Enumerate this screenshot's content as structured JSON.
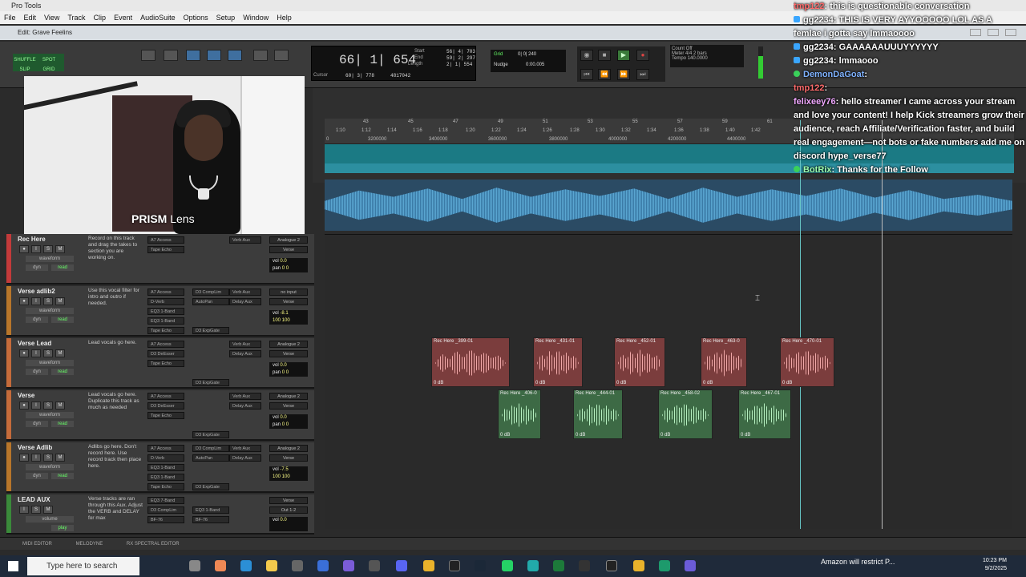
{
  "app": {
    "title": "Pro Tools",
    "edit_window_title": "Edit: Grave Feelins"
  },
  "menu": [
    "File",
    "Edit",
    "View",
    "Track",
    "Clip",
    "Event",
    "AudioSuite",
    "Options",
    "Setup",
    "Window",
    "Help"
  ],
  "toolbar": {
    "modes": [
      "SHUFFLE",
      "SPOT",
      "SLIP",
      "GRID"
    ],
    "grid_label": "Grid",
    "grid_value": "0| 0| 240",
    "nudge_label": "Nudge",
    "nudge_value": "0:00.005",
    "counter_main": "66| 1| 654",
    "start_label": "Start",
    "start_value": "56| 4| 703",
    "end_label": "End",
    "end_value": "59| 2| 297",
    "length_label": "Length",
    "length_value": "2| 1| 554",
    "cursor_label": "Cursor",
    "cursor_value": "60| 3| 778",
    "cursor_samples": "4817042",
    "count_off": "Count Off",
    "meter_label": "Meter",
    "meter_value": "4/4",
    "bars": "2 bars",
    "tempo_label": "Tempo",
    "tempo_value": "140.0000"
  },
  "ruler": {
    "bars": [
      "43",
      "45",
      "47",
      "49",
      "51",
      "53",
      "55",
      "57",
      "59",
      "61"
    ],
    "times": [
      "1:10",
      "1:12",
      "1:14",
      "1:16",
      "1:18",
      "1:20",
      "1:22",
      "1:24",
      "1:26",
      "1:28",
      "1:30",
      "1:32",
      "1:34",
      "1:36",
      "1:38",
      "1:40",
      "1:42"
    ],
    "samples": [
      "3200000",
      "3400000",
      "3600000",
      "3800000",
      "4000000",
      "4200000",
      "4400000"
    ],
    "start_marker": "0"
  },
  "webcam": {
    "overlay_brand": "PRISM",
    "overlay_suffix": "Lens"
  },
  "tracks": [
    {
      "name": "Rec Here",
      "color": "#c33a3a",
      "comment": "Record on this track and drag the takes to section you are working on.",
      "inserts": [
        "A7 Access",
        "Tape Echo"
      ],
      "sends": [
        "Verb Aux"
      ],
      "io": [
        "Analogue 2",
        "Verse"
      ],
      "vol": "0.0",
      "pan": "0 0",
      "view": "waveform",
      "dyn": "dyn",
      "mode": "read"
    },
    {
      "name": "Verse adlib2",
      "color": "#b8762a",
      "comment": "Use this vocal filter for intro and outro if needed.",
      "inserts": [
        "A7 Access",
        "D-Verb",
        "EQ3 1-Band",
        "EQ3 1-Band",
        "Tape Echo"
      ],
      "inserts2": [
        "D3 CompLim",
        "AutoPan",
        "",
        "",
        "D3 ExpGate"
      ],
      "sends": [
        "Verb Aux",
        "Delay Aux"
      ],
      "io": [
        "no input",
        "Verse"
      ],
      "vol": "-8.1",
      "pan": "100 100",
      "view": "waveform",
      "dyn": "dyn",
      "mode": "read"
    },
    {
      "name": "Verse Lead",
      "color": "#c56b3a",
      "comment": "Lead vocals go here.",
      "inserts": [
        "A7 Access",
        "D3 DeEsser",
        "Tape Echo"
      ],
      "inserts2": [
        "",
        "",
        "D3 ExpGate"
      ],
      "sends": [
        "Verb Aux",
        "Delay Aux"
      ],
      "io": [
        "Analogue 2",
        "Verse"
      ],
      "vol": "0.0",
      "pan": "0 0",
      "view": "waveform",
      "dyn": "dyn",
      "mode": "read"
    },
    {
      "name": "Verse",
      "color": "#c56b3a",
      "comment": "Lead vocals go here. Duplicate this track as much as needed",
      "inserts": [
        "A7 Access",
        "D3 DeEsser",
        "Tape Echo"
      ],
      "inserts2": [
        "",
        "",
        "D3 ExpGate"
      ],
      "sends": [
        "Verb Aux",
        "Delay Aux"
      ],
      "io": [
        "Analogue 2",
        "Verse"
      ],
      "vol": "0.0",
      "pan": "0 0",
      "view": "waveform",
      "dyn": "dyn",
      "mode": "read"
    },
    {
      "name": "Verse Adlib",
      "color": "#b8762a",
      "comment": "Adlibs go here. Don't record here. Use record track then place here.",
      "inserts": [
        "A7 Access",
        "D-Verb",
        "EQ3 1-Band",
        "EQ3 1-Band",
        "Tape Echo"
      ],
      "inserts2": [
        "D3 CompLim",
        "AutoPan",
        "",
        "",
        "D3 ExpGate"
      ],
      "sends": [
        "Verb Aux",
        "Delay Aux"
      ],
      "io": [
        "Analogue 2",
        "Verse"
      ],
      "vol": "-7.5",
      "pan": "100 100",
      "view": "waveform",
      "dyn": "dyn",
      "mode": "read"
    },
    {
      "name": "LEAD AUX",
      "color": "#3a8a3a",
      "comment": "Verse tracks are ran through this Aux. Adjust the VERB and DELAY for max",
      "inserts": [
        "EQ3 7-Band",
        "D3 CompLim",
        "BF-76"
      ],
      "inserts2": [
        "",
        "EQ3 1-Band",
        "BF-76"
      ],
      "sends": [],
      "io": [
        "Verse",
        "Out 1-2"
      ],
      "vol": "0.0",
      "pan": "",
      "view": "volume",
      "dyn": "",
      "mode": "play"
    }
  ],
  "clips_red": [
    {
      "name": "Rec Here _399-01",
      "db": "0 dB"
    },
    {
      "name": "Rec Here _431-01",
      "db": "0 dB"
    },
    {
      "name": "Rec Here _452-01",
      "db": "0 dB"
    },
    {
      "name": "Rec Here _463-0",
      "db": "0 dB"
    },
    {
      "name": "Rec Here _470-01",
      "db": "0 dB"
    }
  ],
  "clips_green": [
    {
      "name": "Rec Here _406-0",
      "db": "0 dB"
    },
    {
      "name": "Rec Here _444-01",
      "db": "0 dB"
    },
    {
      "name": "Rec Here _458-02",
      "db": "0 dB"
    },
    {
      "name": "Rec Here _467-01",
      "db": "0 dB"
    }
  ],
  "bottom_tabs": [
    "MIDI EDITOR",
    "MELODYNE",
    "RX SPECTRAL EDITOR"
  ],
  "chat": [
    {
      "user": "tmp122",
      "msg": ": this is questionable conversation",
      "badge": "none"
    },
    {
      "user": "gg2234",
      "msg": ": THIS IS VERY AYYOOOOO LOL AS A",
      "badge": "blue"
    },
    {
      "user": "",
      "msg": "femlae i gotta say lmmaoooo",
      "badge": "none"
    },
    {
      "user": "gg2234",
      "msg": ": GAAAAAAUUUYYYYYY",
      "badge": "blue"
    },
    {
      "user": "gg2234",
      "msg": ": lmmaooo",
      "badge": "blue"
    },
    {
      "user": "DemonDaGoat",
      "msg": ":",
      "badge": "green"
    },
    {
      "user": "tmp122",
      "msg": ":",
      "badge": "none"
    },
    {
      "user": "felixeey76",
      "msg": ": hello streamer I came across your stream",
      "badge": "none"
    },
    {
      "user": "",
      "msg": "and love your content! I help Kick streamers grow their",
      "badge": "none"
    },
    {
      "user": "",
      "msg": "audience, reach Affiliate/Verification faster, and build",
      "badge": "none"
    },
    {
      "user": "",
      "msg": "real engagement—not bots or fake numbers add me on",
      "badge": "none"
    },
    {
      "user": "",
      "msg": "discord hype_verse77",
      "badge": "none"
    },
    {
      "user": "BotRix",
      "msg": ": Thanks for the Follow",
      "badge": "green"
    }
  ],
  "taskbar": {
    "search_placeholder": "Type here to search",
    "notification": "Amazon will restrict P...",
    "time": "10:23 PM",
    "date": "9/2/2025"
  },
  "colors": {
    "accent_teal": "#1b7a84",
    "clip_red": "#7b3d3d",
    "clip_green": "#3d6a45"
  }
}
